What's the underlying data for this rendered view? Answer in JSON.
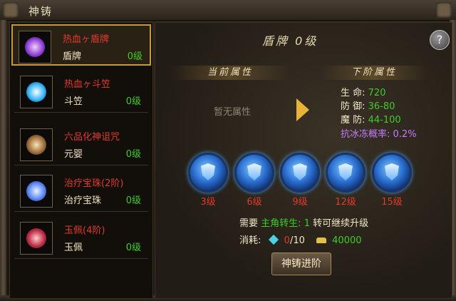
{
  "window": {
    "title": "神铸"
  },
  "items": [
    {
      "name": "热血ヶ盾牌",
      "type": "盾牌",
      "level": "0级",
      "icon": "shield-item-icon",
      "color": "#b06cff"
    },
    {
      "name": "热血ヶ斗笠",
      "type": "斗笠",
      "level": "0级",
      "icon": "hat-item-icon",
      "color": "#5fd0ff"
    },
    {
      "name": "六品化神诅咒",
      "type": "元婴",
      "level": "0级",
      "icon": "spirit-item-icon",
      "color": "#d9a24a"
    },
    {
      "name": "治疗宝珠(2阶)",
      "type": "治疗宝珠",
      "level": "0级",
      "icon": "orb-item-icon",
      "color": "#6fb6ff"
    },
    {
      "name": "玉佩(4阶)",
      "type": "玉佩",
      "level": "0级",
      "icon": "jade-item-icon",
      "color": "#e0456a"
    }
  ],
  "panel": {
    "header": "盾牌  0级",
    "help": "?",
    "current_label": "当前属性",
    "next_label": "下阶属性",
    "no_attr": "暂无属性",
    "stats": [
      {
        "label": "生    命:",
        "value": "720"
      },
      {
        "label": "防    御:",
        "value": "36-80"
      },
      {
        "label": "魔    防:",
        "value": "44-100"
      },
      {
        "label": "抗冰冻概率:",
        "value": "0.2%"
      }
    ],
    "runes": [
      "3级",
      "6级",
      "9级",
      "12级",
      "15级"
    ],
    "need": {
      "prefix": "需要",
      "key": "主角转生:",
      "value": "1",
      "suffix": "转可继续升级"
    },
    "cost": {
      "label": "消耗:",
      "gem_have": "0",
      "gem_need": "/10",
      "gold": "40000"
    },
    "button": "神铸进阶"
  }
}
